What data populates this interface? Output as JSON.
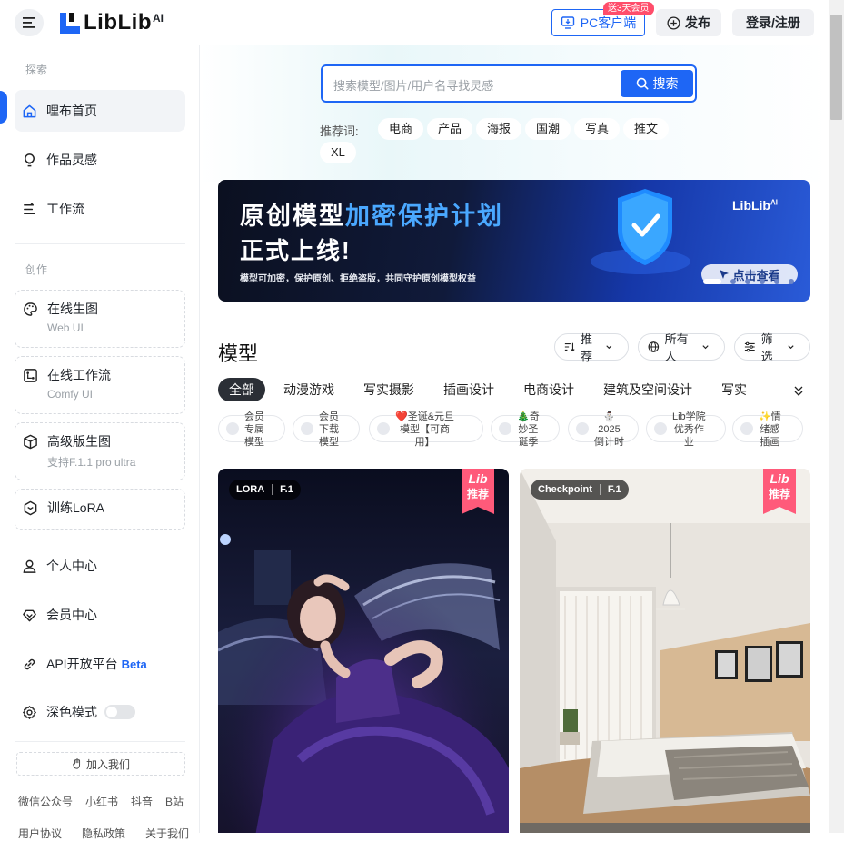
{
  "header": {
    "logo": "LibLib",
    "logo_sup": "AI",
    "pc_client": "PC客户端",
    "pc_badge": "送3天会员",
    "publish": "发布",
    "login": "登录/注册"
  },
  "sidebar": {
    "explore_label": "探索",
    "explore": [
      "哩布首页",
      "作品灵感",
      "工作流"
    ],
    "create_label": "创作",
    "cards": [
      {
        "title": "在线生图",
        "sub": "Web UI"
      },
      {
        "title": "在线工作流",
        "sub": "Comfy UI"
      },
      {
        "title": "高级版生图",
        "sub": "支持F.1.1 pro ultra"
      },
      {
        "title": "训练LoRA",
        "sub": ""
      }
    ],
    "personal": "个人中心",
    "member": "会员中心",
    "api": "API开放平台",
    "api_badge": "Beta",
    "dark_mode": "深色模式",
    "join": "加入我们",
    "footer_links": [
      "微信公众号",
      "小红书",
      "抖音",
      "B站"
    ],
    "footer_links2": [
      "用户协议",
      "隐私政策",
      "关于我们"
    ]
  },
  "search": {
    "placeholder": "搜索模型/图片/用户名寻找灵感",
    "button": "搜索",
    "rec_label": "推荐词:",
    "chips": [
      "电商",
      "产品",
      "海报",
      "国潮",
      "写真",
      "推文",
      "XL"
    ]
  },
  "banner": {
    "line1a": "原创模型",
    "line1b": "加密保护计划",
    "line2": "正式上线!",
    "line3": "模型可加密，保护原创、拒绝盗版，共同守护原创模型权益",
    "cta": "点击查看",
    "logo": "LibLib",
    "logo_sup": "AI"
  },
  "models": {
    "title": "模型",
    "sort": "推荐",
    "owner": "所有人",
    "filter": "筛选",
    "tabs": [
      "全部",
      "动漫游戏",
      "写实摄影",
      "插画设计",
      "电商设计",
      "建筑及空间设计",
      "写实"
    ],
    "subchips": [
      "会员\n专属\n模型",
      "会员\n下载\n模型",
      "❤️圣诞&元旦\n模型【可商\n用】",
      "🎄奇\n妙圣\n诞季",
      "⛄\n2025\n倒计时",
      "Lib学院\n优秀作\n业",
      "✨情\n绪感\n插画"
    ],
    "cards": [
      {
        "type": "LORA",
        "version": "F.1",
        "ribbon_a": "Lib",
        "ribbon_b": "推荐"
      },
      {
        "type": "Checkpoint",
        "version": "F.1",
        "ribbon_a": "Lib",
        "ribbon_b": "推荐"
      }
    ]
  },
  "colors": {
    "accent": "#1e66f5",
    "ribbon": "#ff5a7a",
    "badge": "#ff4d6a"
  }
}
